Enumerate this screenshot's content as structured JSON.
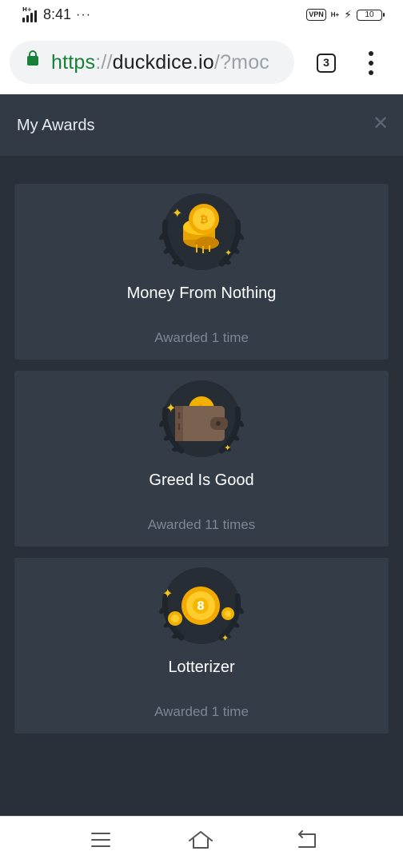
{
  "status_bar": {
    "network": "H+",
    "time": "8:41",
    "more": "···",
    "vpn": "VPN",
    "network_right": "H+",
    "battery": "10"
  },
  "browser": {
    "url_scheme": "https",
    "url_sep": "://",
    "url_host": "duckdice.io",
    "url_path": "/?moc",
    "tab_count": "3"
  },
  "modal": {
    "title": "My Awards",
    "close_icon": "close-icon"
  },
  "awards": [
    {
      "title": "Money From Nothing",
      "subtitle": "Awarded 1 time",
      "icon": "gold-coins-icon"
    },
    {
      "title": "Greed Is Good",
      "subtitle": "Awarded 11 times",
      "icon": "bitcoin-wallet-icon"
    },
    {
      "title": "Lotterizer",
      "subtitle": "Awarded 1 time",
      "icon": "lottery-ball-icon"
    }
  ],
  "nav": {
    "menu_icon": "menu-icon",
    "home_icon": "home-icon",
    "back_icon": "back-icon"
  },
  "colors": {
    "modal_bg": "#29303a",
    "card_bg": "#343c47",
    "gold": "#f5b800",
    "secure_green": "#188038"
  }
}
